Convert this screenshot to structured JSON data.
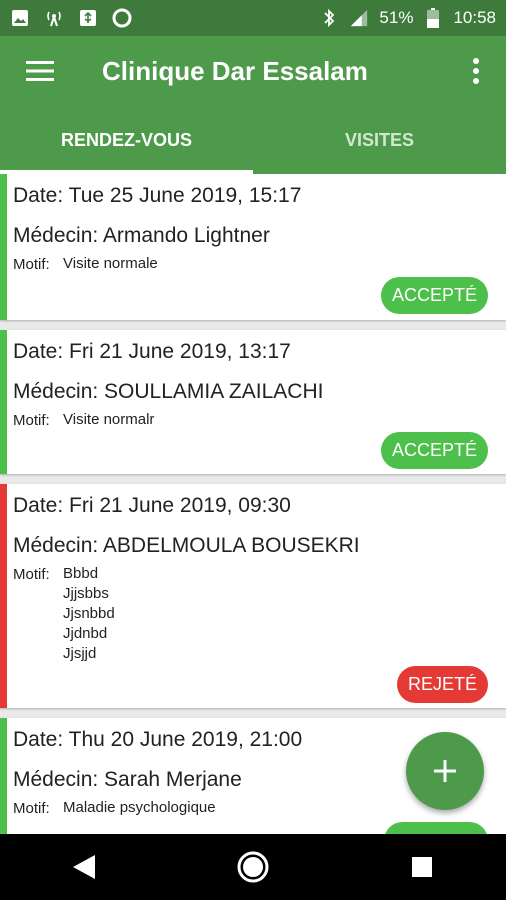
{
  "status": {
    "battery": "51%",
    "time": "10:58"
  },
  "appbar": {
    "title": "Clinique Dar Essalam"
  },
  "tabs": [
    {
      "label": "RENDEZ-VOUS",
      "active": true
    },
    {
      "label": "VISITES",
      "active": false
    }
  ],
  "appointments": [
    {
      "date": "Date: Tue 25 June 2019, 15:17",
      "doctor": "Médecin: Armando Lightner",
      "motif_label": "Motif:",
      "motif": "Visite normale",
      "status": "ACCEPTÉ",
      "status_color": "#4cc04a"
    },
    {
      "date": "Date: Fri 21 June 2019, 13:17",
      "doctor": "Médecin: SOULLAMIA ZAILACHI",
      "motif_label": "Motif:",
      "motif": "Visite normalr",
      "status": "ACCEPTÉ",
      "status_color": "#4cc04a"
    },
    {
      "date": "Date: Fri 21 June 2019, 09:30",
      "doctor": "Médecin: ABDELMOULA BOUSEKRI",
      "motif_label": "Motif:",
      "motif": "Bbbd\nJjjsbbs\nJjsnbbd\nJjdnbd\nJjsjjd",
      "status": "REJETÉ",
      "status_color": "#e53935"
    },
    {
      "date": "Date: Thu 20 June 2019, 21:00",
      "doctor": "Médecin: Sarah Merjane",
      "motif_label": "Motif:",
      "motif": "Maladie psychologique",
      "status": "",
      "status_color": "#4cc04a"
    }
  ],
  "icons": {
    "menu": "menu-icon",
    "more": "more-vert-icon",
    "fab": "add-icon",
    "nav_back": "back-triangle-icon",
    "nav_home": "home-circle-icon",
    "nav_recents": "recents-square-icon"
  },
  "colors": {
    "primary": "#4e9a4b",
    "status_bar": "#3d7a3c",
    "accepted": "#4cc04a",
    "rejected": "#e53935"
  }
}
